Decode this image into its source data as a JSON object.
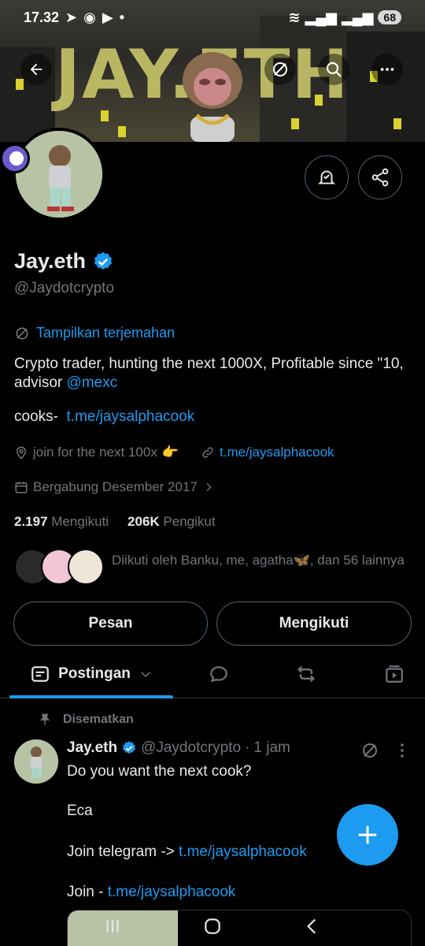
{
  "status_bar": {
    "time": "17.32",
    "battery": "68"
  },
  "banner": {
    "text": "JAY.ETH"
  },
  "profile": {
    "name": "Jay.eth",
    "handle": "@Jaydotcrypto",
    "translate_label": "Tampilkan terjemahan",
    "bio_text": "Crypto trader, hunting the next 1000X, Profitable since \"10, advisor ",
    "bio_mention": "@mexc",
    "cooks_label": "cooks-",
    "cooks_link": "t.me/jaysalphacook",
    "location": "join for the next 100x",
    "location_emoji": "👉",
    "website": "t.me/jaysalphacook",
    "joined": "Bergabung Desember 2017",
    "following_count": "2.197",
    "following_label": "Mengikuti",
    "followers_count": "206K",
    "followers_label": "Pengikut",
    "followed_by": "Diikuti oleh Banku, me, agatha🦋, dan 56 lainnya"
  },
  "actions": {
    "message": "Pesan",
    "following": "Mengikuti"
  },
  "tabs": {
    "posts": "Postingan"
  },
  "pinned_label": "Disematkan",
  "post": {
    "name": "Jay.eth",
    "handle": "@Jaydotcrypto",
    "sep": "·",
    "time": "1 jam",
    "line1": "Do you want the next cook?",
    "line2": "Eca",
    "line3_text": "Join telegram -> ",
    "line3_link": "t.me/jaysalphacook",
    "line4_text": "Join - ",
    "line4_link": "t.me/jaysalphacook"
  },
  "colors": {
    "accent": "#1d9bf0",
    "background": "#000000",
    "muted": "#71767b"
  }
}
